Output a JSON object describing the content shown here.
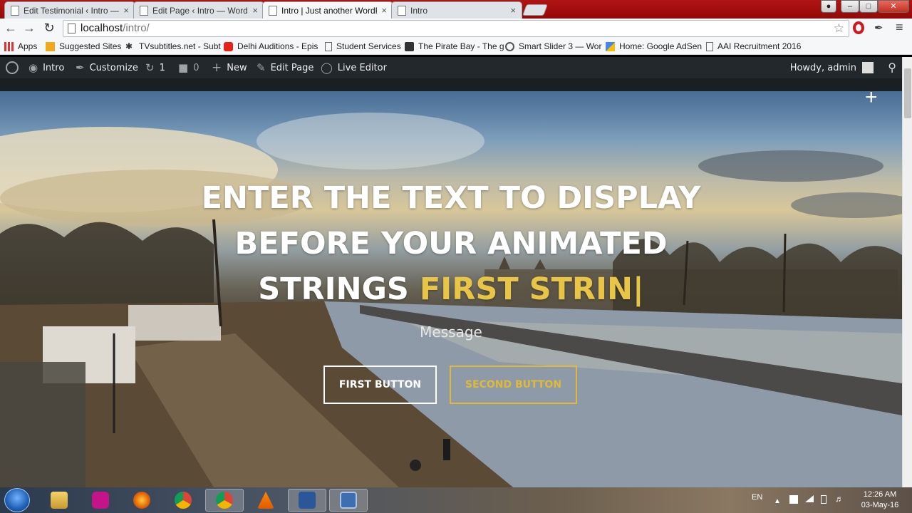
{
  "browser": {
    "tabs": [
      {
        "title": "Edit Testimonial ‹ Intro —",
        "active": false
      },
      {
        "title": "Edit Page ‹ Intro — Word",
        "active": false
      },
      {
        "title": "Intro | Just another WordP",
        "active": true
      },
      {
        "title": "Intro",
        "active": false
      }
    ],
    "close_glyph": "×",
    "url_host": "localhost",
    "url_path": "/intro/",
    "bookmarks": [
      {
        "label": "Apps",
        "icon": "apps-grid-icon"
      },
      {
        "label": "Suggested Sites",
        "icon": "suggested-sites-icon"
      },
      {
        "label": "TVsubtitles.net - Subt",
        "icon": "tvsubtitles-icon"
      },
      {
        "label": "Delhi Auditions - Epis",
        "icon": "youtube-icon"
      },
      {
        "label": "Student Services",
        "icon": "page-icon"
      },
      {
        "label": "The Pirate Bay - The g",
        "icon": "pirate-ship-icon"
      },
      {
        "label": "Smart Slider 3 — Wor",
        "icon": "wordpress-icon"
      },
      {
        "label": "Home: Google AdSen",
        "icon": "adsense-icon"
      },
      {
        "label": "AAI Recruitment 2016",
        "icon": "page-icon"
      }
    ]
  },
  "adminbar": {
    "site_name": "Intro",
    "customize": "Customize",
    "updates_count": "1",
    "comments_count": "0",
    "new_label": "New",
    "edit_page": "Edit Page",
    "live_editor": "Live Editor",
    "howdy": "Howdy, admin"
  },
  "hero": {
    "headline_line1": "ENTER THE TEXT TO DISPLAY",
    "headline_line2": "BEFORE YOUR ANIMATED",
    "headline_line3_prefix": "STRINGS ",
    "typed_string": "FIRST STRIN",
    "caret": "|",
    "message": "Message",
    "button1": "FIRST BUTTON",
    "button2": "SECOND BUTTON",
    "accent_color": "#e8c547"
  },
  "taskbar": {
    "items": [
      "start-orb",
      "file-explorer",
      "app-launcher",
      "firefox",
      "chrome",
      "chrome-active",
      "vlc",
      "word",
      "save-media"
    ],
    "lang": "EN",
    "time": "12:26 AM",
    "date": "03-May-16"
  }
}
